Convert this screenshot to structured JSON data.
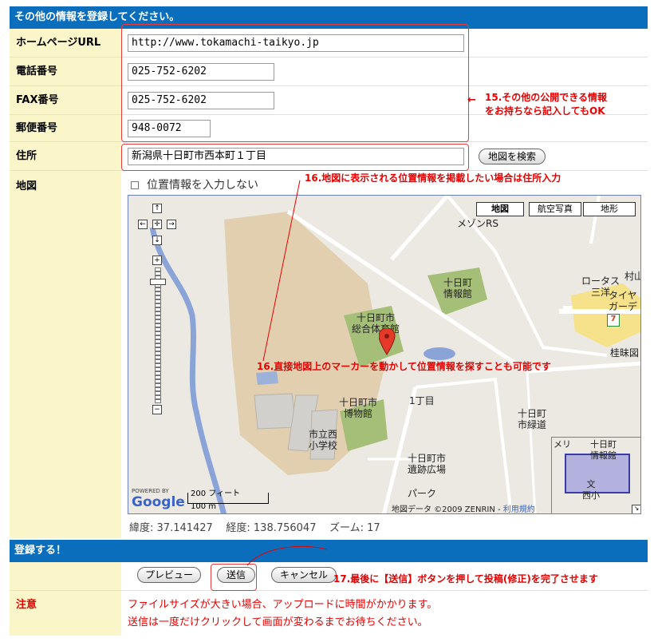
{
  "section1_title": "その他の情報を登録してください。",
  "fields": {
    "homepage": {
      "label": "ホームページURL",
      "value": "http://www.tokamachi-taikyo.jp"
    },
    "phone": {
      "label": "電話番号",
      "value": "025-752-6202"
    },
    "fax": {
      "label": "FAX番号",
      "value": "025-752-6202"
    },
    "postal": {
      "label": "郵便番号",
      "value": "948-0072"
    },
    "address": {
      "label": "住所",
      "value": "新潟県十日町市西本町１丁目"
    },
    "map": {
      "label": "地図"
    }
  },
  "buttons": {
    "search_map": "地図を検索",
    "preview": "プレビュー",
    "submit": "送信",
    "cancel": "キャンセル"
  },
  "checkbox_no_location": "位置情報を入力しない",
  "annotations": {
    "note15_line1": "15.その他の公開できる情報",
    "note15_line2": "をお持ちなら記入してもOK",
    "note16": "16.地図に表示される位置情報を掲載したい場合は住所入力",
    "note16b": "16.直接地図上のマーカーを動かして位置情報を探すことも可能です",
    "note17": "17.最後に【送信】ボタンを押して投稿(修正)を完了させます"
  },
  "map": {
    "types": [
      "地図",
      "航空写真",
      "地形"
    ],
    "labels": {
      "mezon": "メゾンRS",
      "joho1": "十日町\n情報館",
      "lotus": "ロータス\n三洋",
      "murayama": "村山",
      "taiya": "タイヤ\nガーデ",
      "keimido": "桂昧図",
      "gym": "十日町市\n総合体育館",
      "museum": "十日町市\n博物館",
      "itchome": "1丁目",
      "school": "市立西\n小学校",
      "ruins": "十日町市\n遺跡広場",
      "park": "パーク",
      "greenway": "十日町\n市緑道",
      "mini_joho": "十日町\n情報館",
      "mini_bun": "文\n西小",
      "mini_meri": "メリ"
    },
    "scale_ft": "200 フィート",
    "scale_m": "100 m",
    "powered_by": "POWERED BY",
    "google": "Google",
    "copyright": "地図データ ©2009 ZENRIN - ",
    "terms": "利用規約",
    "coords": {
      "lat_label": "緯度:",
      "lat": "37.141427",
      "lng_label": "経度:",
      "lng": "138.756047",
      "zoom_label": "ズーム:",
      "zoom": "17"
    }
  },
  "section2_title": "登録する！",
  "notice": {
    "label": "注意",
    "line1": "ファイルサイズが大きい場合、アップロードに時間がかかります。",
    "line2": "送信は一度だけクリックして画面が変わるまでお待ちください。"
  }
}
